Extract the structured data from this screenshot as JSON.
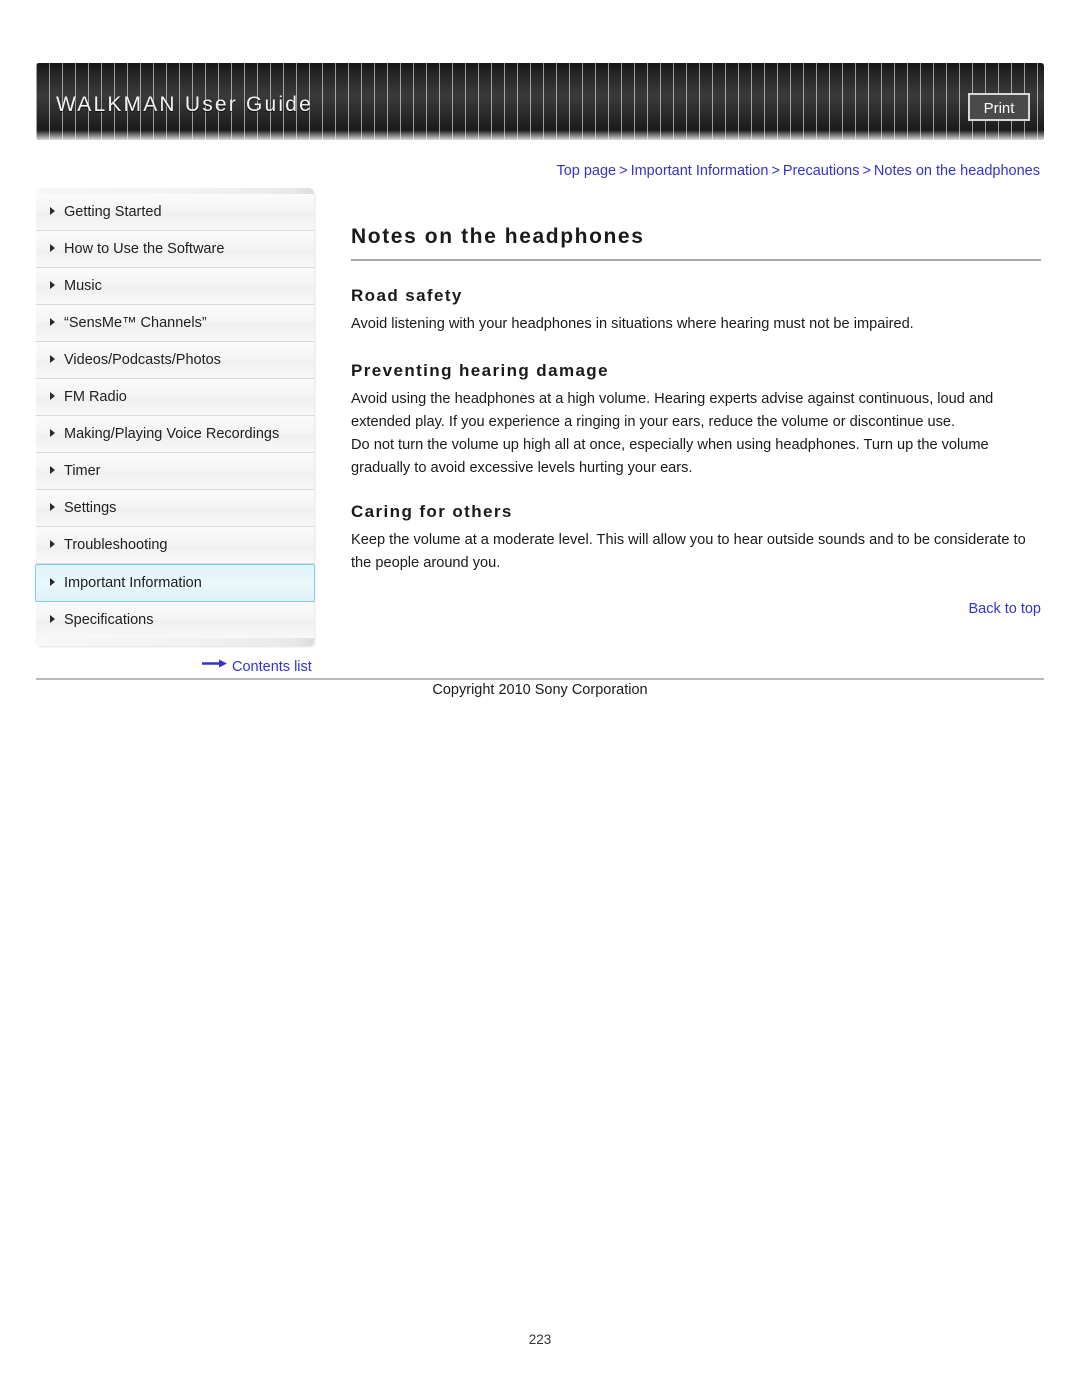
{
  "header": {
    "title": "WALKMAN User Guide",
    "print_label": "Print"
  },
  "breadcrumb": {
    "items": [
      "Top page",
      "Important Information",
      "Precautions",
      "Notes on the headphones"
    ],
    "separator": ">"
  },
  "sidebar": {
    "items": [
      {
        "label": "Getting Started",
        "active": false
      },
      {
        "label": "How to Use the Software",
        "active": false
      },
      {
        "label": "Music",
        "active": false
      },
      {
        "label": "“SensMe™ Channels”",
        "active": false
      },
      {
        "label": "Videos/Podcasts/Photos",
        "active": false
      },
      {
        "label": "FM Radio",
        "active": false
      },
      {
        "label": "Making/Playing Voice Recordings",
        "active": false
      },
      {
        "label": "Timer",
        "active": false
      },
      {
        "label": "Settings",
        "active": false
      },
      {
        "label": "Troubleshooting",
        "active": false
      },
      {
        "label": "Important Information",
        "active": true
      },
      {
        "label": "Specifications",
        "active": false
      }
    ],
    "contents_list_label": "Contents list"
  },
  "main": {
    "page_title": "Notes on the headphones",
    "sections": [
      {
        "heading": "Road safety",
        "paragraphs": [
          "Avoid listening with your headphones in situations where hearing must not be impaired."
        ]
      },
      {
        "heading": "Preventing hearing damage",
        "paragraphs": [
          "Avoid using the headphones at a high volume. Hearing experts advise against continuous, loud and extended play. If you experience a ringing in your ears, reduce the volume or discontinue use.",
          "Do not turn the volume up high all at once, especially when using headphones. Turn up the volume gradually to avoid excessive levels hurting your ears."
        ]
      },
      {
        "heading": "Caring for others",
        "paragraphs": [
          "Keep the volume at a moderate level. This will allow you to hear outside sounds and to be considerate to the people around you."
        ]
      }
    ],
    "back_to_top_label": "Back to top"
  },
  "footer": {
    "copyright": "Copyright 2010 Sony Corporation",
    "page_number": "223"
  },
  "colors": {
    "link": "#3333cc",
    "header_bg": "#2b2b2b",
    "active_nav_bg": "#e2f5fa",
    "active_nav_border": "#7fd0e2",
    "rule": "#a8a8a8"
  }
}
